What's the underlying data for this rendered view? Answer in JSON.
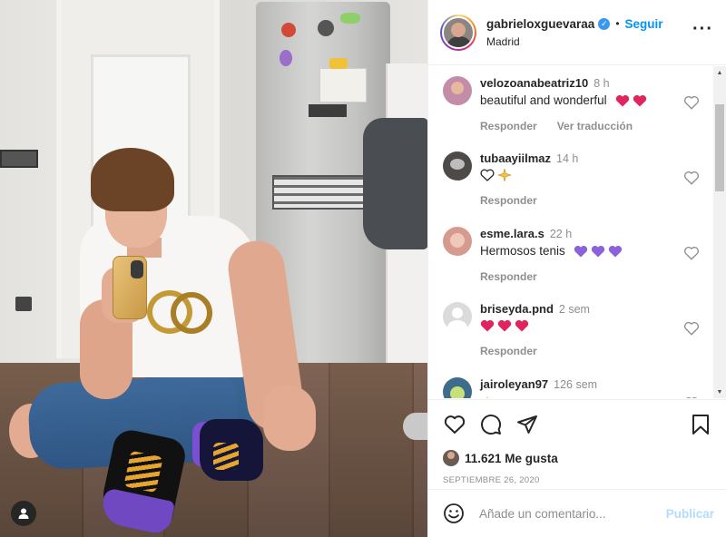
{
  "post": {
    "author": {
      "username": "gabrieloxguevaraa",
      "verified": true,
      "follow_label": "Seguir",
      "location": "Madrid",
      "separator": "•"
    },
    "more_icon": "more-options-icon",
    "tag_icon": "user-tag-icon"
  },
  "comments": [
    {
      "user": "velozoanabeatriz10",
      "time": "8 h",
      "text": "beautiful and wonderful",
      "emojis": [
        "red-heart",
        "red-heart"
      ],
      "actions": [
        "Responder",
        "Ver traducción"
      ],
      "avatar_color": "#c38ca8"
    },
    {
      "user": "tubaayiilmaz",
      "time": "14 h",
      "text": "",
      "emojis": [
        "white-heart",
        "sparkle"
      ],
      "actions": [
        "Responder"
      ],
      "avatar_color": "#4d4a47"
    },
    {
      "user": "esme.lara.s",
      "time": "22 h",
      "text": "Hermosos tenis",
      "emojis": [
        "purple-heart",
        "purple-heart",
        "purple-heart"
      ],
      "actions": [
        "Responder"
      ],
      "avatar_color": "#d79a8f"
    },
    {
      "user": "briseyda.pnd",
      "time": "2 sem",
      "text": "",
      "emojis": [
        "red-heart",
        "red-heart",
        "red-heart"
      ],
      "actions": [
        "Responder"
      ],
      "avatar_color": "#dbdbdb"
    },
    {
      "user": "jairoleyan97",
      "time": "126 sem",
      "text": "",
      "emojis": [
        "crown"
      ],
      "actions": [],
      "avatar_color": "#3e6d8c"
    }
  ],
  "footer": {
    "likes": "11.621 Me gusta",
    "date": "SEPTIEMBRE 26, 2020",
    "icons": [
      "like-heart-icon",
      "comment-icon",
      "share-icon",
      "save-bookmark-icon"
    ]
  },
  "add_comment": {
    "placeholder": "Añade un comentario...",
    "publish_label": "Publicar"
  },
  "colors": {
    "accent": "#0095f6",
    "verified": "#3897f0",
    "muted": "#8e8e8e",
    "publish_disabled": "#b3dbff",
    "red_heart": "#e0245e",
    "purple_heart": "#8b62d9"
  }
}
